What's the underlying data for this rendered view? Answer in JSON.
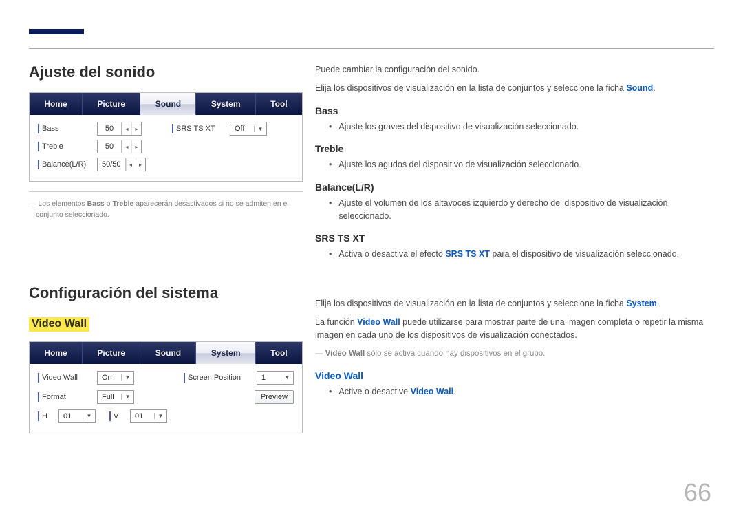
{
  "pageNumber": "66",
  "section1": {
    "title": "Ajuste del sonido",
    "panel": {
      "tabs": [
        "Home",
        "Picture",
        "Sound",
        "System",
        "Tool"
      ],
      "activeTab": 2,
      "left": [
        {
          "label": "Bass",
          "value": "50"
        },
        {
          "label": "Treble",
          "value": "50"
        },
        {
          "label": "Balance(L/R)",
          "value": "50/50"
        }
      ],
      "right": [
        {
          "label": "SRS TS XT",
          "value": "Off"
        }
      ]
    },
    "footnote_pre": "Los elementos ",
    "footnote_b1": "Bass",
    "footnote_mid1": " o ",
    "footnote_b2": "Treble",
    "footnote_rest": " aparecerán desactivados si no se admiten en el conjunto seleccionado.",
    "intro1": "Puede cambiar la configuración del sonido.",
    "intro2a": "Elija los dispositivos de visualización en la lista de conjuntos y seleccione la ficha ",
    "intro2b": "Sound",
    "intro2c": ".",
    "items": {
      "bass": {
        "h": "Bass",
        "t": "Ajuste los graves del dispositivo de visualización seleccionado."
      },
      "treble": {
        "h": "Treble",
        "t": "Ajuste los agudos del dispositivo de visualización seleccionado."
      },
      "balance": {
        "h": "Balance(L/R)",
        "t": "Ajuste el volumen de los altavoces izquierdo y derecho del dispositivo de visualización seleccionado."
      },
      "srs": {
        "h": "SRS TS XT",
        "pre": "Activa o desactiva el efecto ",
        "kw": "SRS TS XT",
        "post": " para el dispositivo de visualización seleccionado."
      }
    }
  },
  "section2": {
    "title": "Configuración del sistema",
    "highlight": "Video Wall",
    "panel": {
      "tabs": [
        "Home",
        "Picture",
        "Sound",
        "System",
        "Tool"
      ],
      "activeTab": 3,
      "rows": {
        "videoWall": {
          "label": "Video Wall",
          "value": "On"
        },
        "screenPos": {
          "label": "Screen Position",
          "value": "1"
        },
        "format": {
          "label": "Format",
          "value": "Full"
        },
        "h": {
          "label": "H",
          "value": "01"
        },
        "v": {
          "label": "V",
          "value": "01"
        },
        "preview": {
          "label": "Preview"
        }
      }
    },
    "intro1a": "Elija los dispositivos de visualización en la lista de conjuntos y seleccione la ficha ",
    "intro1b": "System",
    "intro1c": ".",
    "intro2a": "La función ",
    "intro2b": "Video Wall",
    "intro2c": " puede utilizarse para mostrar parte de una imagen completa o repetir la misma imagen en cada uno de los dispositivos de visualización conectados.",
    "note_b": "Video Wall",
    "note_rest": " sólo se activa cuando hay dispositivos en el grupo.",
    "vw": {
      "h": "Video Wall",
      "pre": "Active o desactive ",
      "kw": "Video Wall",
      "post": "."
    }
  }
}
